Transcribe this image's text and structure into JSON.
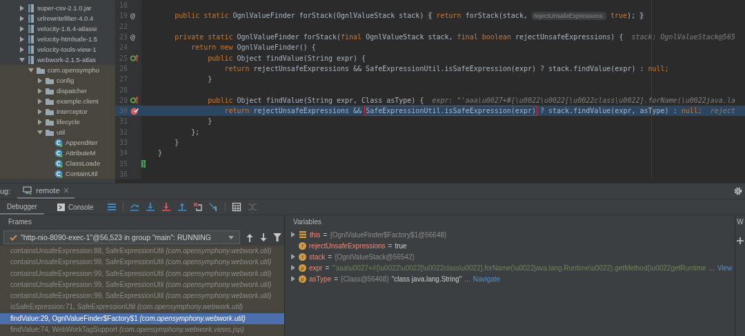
{
  "project_tree": [
    {
      "label": "super-csv-2.1.0.jar",
      "kind": "jar",
      "expanded": false
    },
    {
      "label": "urlrewritefilter-4.0.4",
      "kind": "jar",
      "expanded": false
    },
    {
      "label": "velocity-1.6.4-atlassi",
      "kind": "jar",
      "expanded": false
    },
    {
      "label": "velocity-htmlsafe-1.5",
      "kind": "jar",
      "expanded": false
    },
    {
      "label": "velocity-tools-view-1",
      "kind": "jar",
      "expanded": false
    },
    {
      "label": "webwork-2.1.5-atlas",
      "kind": "jar",
      "expanded": true,
      "children": [
        {
          "label": "com.opensympho",
          "kind": "package",
          "expanded": true,
          "children": [
            {
              "label": "config",
              "kind": "package",
              "expanded": false
            },
            {
              "label": "dispatcher",
              "kind": "package",
              "expanded": false
            },
            {
              "label": "example.client",
              "kind": "package",
              "expanded": false
            },
            {
              "label": "interceptor",
              "kind": "package",
              "expanded": false
            },
            {
              "label": "lifecycle",
              "kind": "package",
              "expanded": false
            },
            {
              "label": "util",
              "kind": "package",
              "expanded": true,
              "children": [
                {
                  "label": "AppendIter",
                  "kind": "class"
                },
                {
                  "label": "AttributeM",
                  "kind": "class"
                },
                {
                  "label": "ClassLoade",
                  "kind": "class"
                },
                {
                  "label": "ContainUtil",
                  "kind": "class"
                }
              ]
            }
          ]
        }
      ]
    }
  ],
  "editor": {
    "lines": [
      {
        "number": "18",
        "current": false
      },
      {
        "number": "19",
        "current": false,
        "gutter": {
          "kind": "annotation",
          "text": "@"
        },
        "segments": [
          {
            "kind": "kw",
            "text": "        public static "
          },
          {
            "kind": "plain",
            "text": "OgnlValueFinder forStack(OgnlValueStack stack) "
          },
          {
            "kind": "fold",
            "text": "{"
          },
          {
            "kind": "kw",
            "text": " return "
          },
          {
            "kind": "plain",
            "text": "forStack(stack, "
          },
          {
            "kind": "hint",
            "text": "rejectUnsafeExpressions:"
          },
          {
            "kind": "kw",
            "text": " true"
          },
          {
            "kind": "plain",
            "text": "); "
          },
          {
            "kind": "fold",
            "text": "}"
          }
        ]
      },
      {
        "number": "22",
        "current": false
      },
      {
        "number": "23",
        "current": false,
        "gutter": {
          "kind": "annotation",
          "text": "@"
        },
        "segments": [
          {
            "kind": "kw",
            "text": "        private static "
          },
          {
            "kind": "plain",
            "text": "OgnlValueFinder forStack("
          },
          {
            "kind": "kw",
            "text": "final "
          },
          {
            "kind": "plain",
            "text": "OgnlValueStack stack, "
          },
          {
            "kind": "kw",
            "text": "final boolean "
          },
          {
            "kind": "plain",
            "text": "rejectUnsafeExpressions) {"
          },
          {
            "kind": "debug",
            "text": "stack: OgnlValueStack@565"
          }
        ]
      },
      {
        "number": "24",
        "current": false,
        "segments": [
          {
            "kind": "kw",
            "text": "            return new "
          },
          {
            "kind": "plain",
            "text": "OgnlValueFinder() {"
          }
        ]
      },
      {
        "number": "25",
        "current": false,
        "gutter": {
          "kind": "override"
        },
        "segments": [
          {
            "kind": "kw",
            "text": "                public "
          },
          {
            "kind": "plain",
            "text": "Object findValue(String expr) {"
          }
        ]
      },
      {
        "number": "26",
        "current": false,
        "segments": [
          {
            "kind": "kw",
            "text": "                    return "
          },
          {
            "kind": "plain",
            "text": "rejectUnsafeExpressions && SafeExpressionUtil.isSafeExpression(expr) ? stack.findValue(expr) : "
          },
          {
            "kind": "kw",
            "text": "null;"
          }
        ]
      },
      {
        "number": "27",
        "current": false,
        "segments": [
          {
            "kind": "plain",
            "text": "                }"
          }
        ]
      },
      {
        "number": "28",
        "current": false
      },
      {
        "number": "29",
        "current": false,
        "gutter": {
          "kind": "override"
        },
        "segments": [
          {
            "kind": "kw",
            "text": "                public "
          },
          {
            "kind": "plain",
            "text": "Object findValue(String expr, Class asType) {"
          },
          {
            "kind": "debug",
            "text": "expr: \"'aaa\\u0027+#{\\u0022\\u0022[\\u0022class\\u0022].forName(\\u0022java.la"
          }
        ]
      },
      {
        "number": "30",
        "current": true,
        "gutter": {
          "kind": "breakpoint"
        },
        "segments": [
          {
            "kind": "kw",
            "text": "                    return "
          },
          {
            "kind": "plain",
            "text": "rejectUnsafeExpressions && "
          },
          {
            "kind": "boxed",
            "text": "SafeExpressionUtil.isSafeExpression(expr)"
          },
          {
            "kind": "plain",
            "text": " ? stack.findValue(expr, asType) : "
          },
          {
            "kind": "kw",
            "text": "null;"
          },
          {
            "kind": "debug",
            "text": "reject"
          }
        ]
      },
      {
        "number": "31",
        "current": false,
        "segments": [
          {
            "kind": "plain",
            "text": "                }"
          }
        ]
      },
      {
        "number": "32",
        "current": false,
        "segments": [
          {
            "kind": "plain",
            "text": "            };"
          }
        ]
      },
      {
        "number": "33",
        "current": false,
        "segments": [
          {
            "kind": "plain",
            "text": "        }"
          }
        ]
      },
      {
        "number": "34",
        "current": false,
        "segments": [
          {
            "kind": "plain",
            "text": "    }"
          }
        ]
      },
      {
        "number": "35",
        "current": false,
        "segments": [
          {
            "kind": "match",
            "text": "}"
          }
        ]
      },
      {
        "number": "36",
        "current": false
      }
    ]
  },
  "debug": {
    "label": "ug:",
    "session_tab": {
      "label": "remote",
      "selected": true
    },
    "view_tabs": [
      {
        "label": "Debugger",
        "selected": true
      },
      {
        "label": "Console",
        "selected": false
      }
    ],
    "frames": {
      "title": "Frames",
      "thread": "\"http-nio-8090-exec-1\"@56,523 in group \"main\": RUNNING",
      "items": [
        {
          "method": "containsUnsafeExpression:88, SafeExpressionUtil",
          "package": "(com.opensymphony.webwork.util)",
          "selected": false
        },
        {
          "method": "containsUnsafeExpression:99, SafeExpressionUtil",
          "package": "(com.opensymphony.webwork.util)",
          "selected": false
        },
        {
          "method": "containsUnsafeExpression:99, SafeExpressionUtil",
          "package": "(com.opensymphony.webwork.util)",
          "selected": false
        },
        {
          "method": "containsUnsafeExpression:99, SafeExpressionUtil",
          "package": "(com.opensymphony.webwork.util)",
          "selected": false
        },
        {
          "method": "containsUnsafeExpression:99, SafeExpressionUtil",
          "package": "(com.opensymphony.webwork.util)",
          "selected": false
        },
        {
          "method": "isSafeExpression:71, SafeExpressionUtil",
          "package": "(com.opensymphony.webwork.util)",
          "selected": false
        },
        {
          "method": "findValue:29, OgnlValueFinder$Factory$1",
          "package": "(com.opensymphony.webwork.util)",
          "selected": true
        },
        {
          "method": "findValue:74, WebWorkTagSupport",
          "package": "(com.opensymphony.webwork.views.jsp)",
          "selected": false
        }
      ]
    },
    "variables": {
      "title": "Variables",
      "items": [
        {
          "name": "this",
          "kind": "object",
          "expandable": true,
          "operator": "=",
          "value": [
            {
              "kind": "ref",
              "text": "{OgnlValueFinder$Factory$1@56648}"
            }
          ]
        },
        {
          "name": "rejectUnsafeExpressions",
          "kind": "field",
          "badge": "f",
          "expandable": false,
          "operator": "=",
          "value": [
            {
              "kind": "literal",
              "text": "true"
            }
          ]
        },
        {
          "name": "stack",
          "kind": "field",
          "badge": "f",
          "expandable": true,
          "operator": "=",
          "value": [
            {
              "kind": "ref",
              "text": "{OgnlValueStack@56542}"
            }
          ]
        },
        {
          "name": "expr",
          "kind": "parameter",
          "badge": "p",
          "expandable": true,
          "operator": "=",
          "value": [
            {
              "kind": "string",
              "text": "\"'aaa\\u0027+#{\\u0022\\u0022[\\u0022class\\u0022].forName(\\u0022java.lang.Runtime\\u0022).getMethod(\\u0022getRuntime"
            },
            {
              "kind": "ref",
              "text": "..."
            },
            {
              "kind": "link",
              "text": "View"
            }
          ]
        },
        {
          "name": "asType",
          "kind": "parameter",
          "badge": "p",
          "expandable": true,
          "operator": "=",
          "value": [
            {
              "kind": "ref",
              "text": "{Class@56468}"
            },
            {
              "kind": "literal",
              "text": "\"class java.lang.String\""
            },
            {
              "kind": "ref",
              "text": "..."
            },
            {
              "kind": "link",
              "text": "Navigate"
            }
          ]
        }
      ]
    },
    "watches": {
      "title": "W"
    }
  }
}
